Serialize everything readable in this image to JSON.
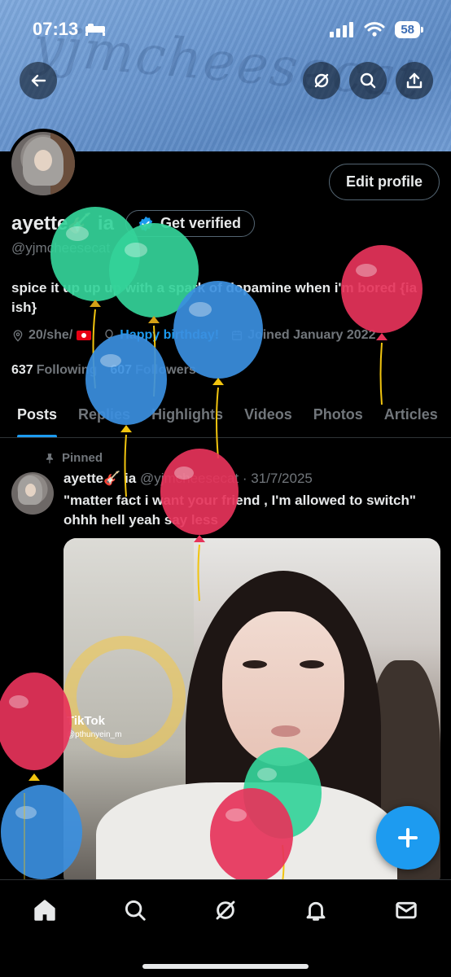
{
  "status_bar": {
    "time": "07:13",
    "battery": "58"
  },
  "banner": {
    "text": "yjmcheesecat"
  },
  "profile": {
    "edit_label": "Edit profile",
    "display_name": "ayette🎸 ia",
    "verify_label": "Get verified",
    "handle": "@yjmcheesecat",
    "bio": "spice it up up up with a spark of dopamine when i'm bored {ia ish}",
    "location": "20/she/",
    "birthday": "Happy birthday!",
    "joined": "Joined January 2022",
    "following_count": "637",
    "following_label": "Following",
    "followers_count": "607",
    "followers_label": "Followers"
  },
  "tabs": [
    {
      "label": "Posts"
    },
    {
      "label": "Replies"
    },
    {
      "label": "Highlights"
    },
    {
      "label": "Videos"
    },
    {
      "label": "Photos"
    },
    {
      "label": "Articles"
    }
  ],
  "post": {
    "pinned_label": "Pinned",
    "author": "ayette🎸 ia",
    "meta": "@yjmcheesecat · 31/7/2025",
    "text": "\"matter fact i want your friend , I'm allowed to switch\" ohhh hell yeah say less",
    "media_watermark": "TikTok",
    "media_watermark_handle": "@pthunyein_m"
  },
  "nav": {
    "icons": [
      "home-icon",
      "search-icon",
      "grok-icon",
      "notifications-icon",
      "messages-icon"
    ]
  },
  "colors": {
    "accent": "#1d9bf0",
    "balloon_green": "#34d399",
    "balloon_blue": "#3b8fe0",
    "balloon_red": "#e6335a"
  }
}
